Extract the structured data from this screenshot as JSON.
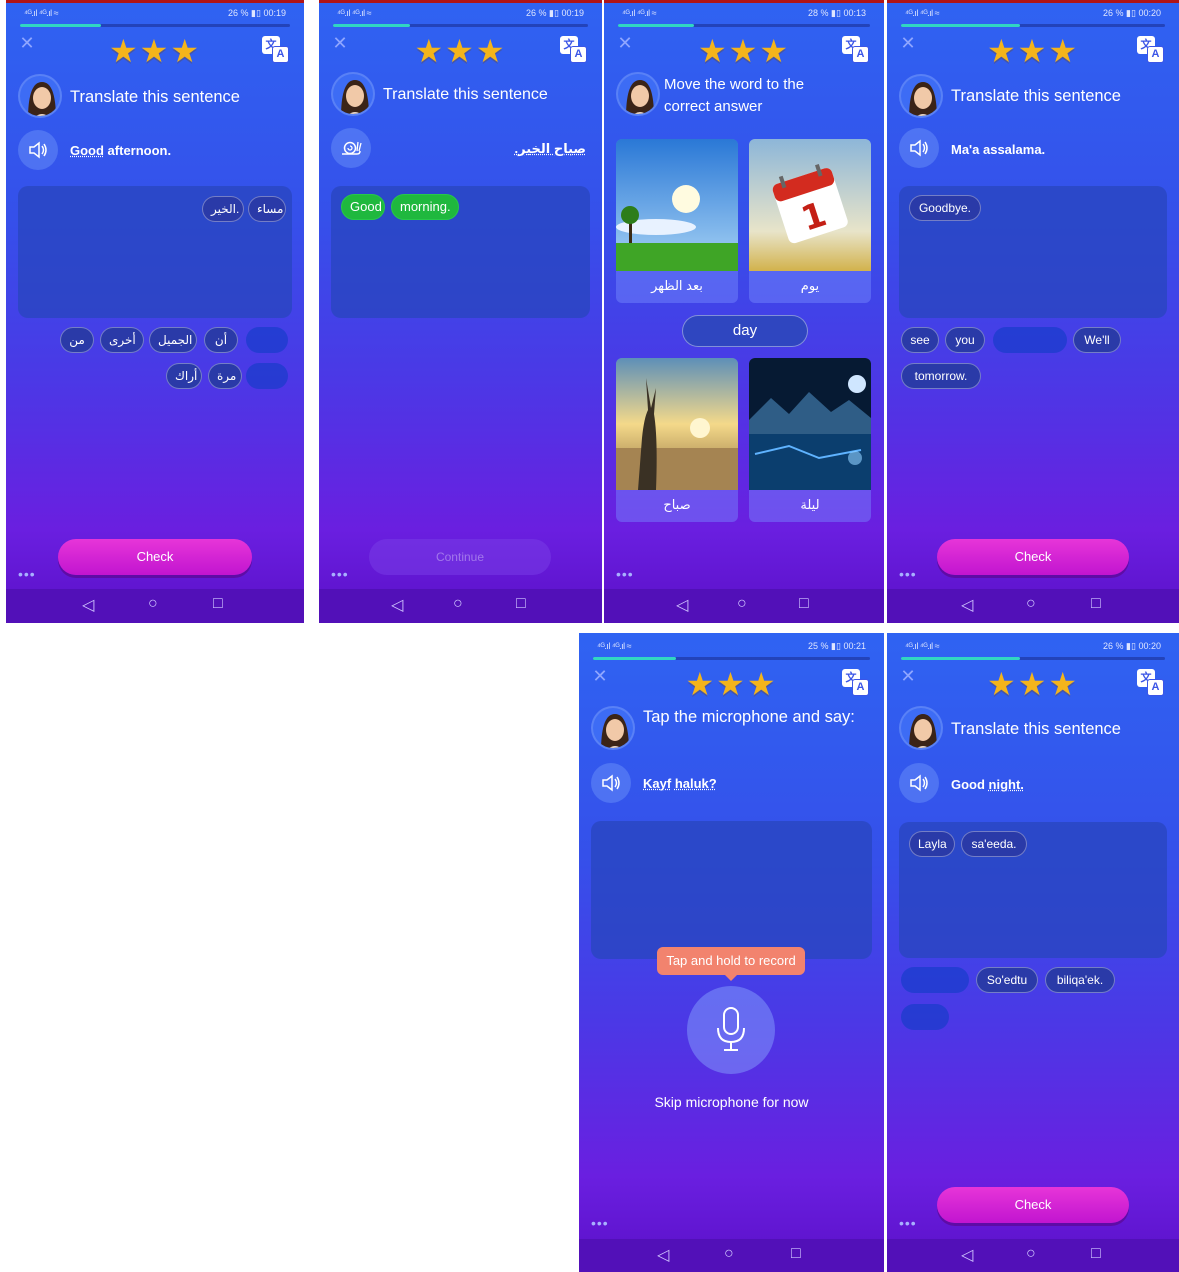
{
  "common": {
    "signal_text": "⁴ᴳ.ıl ⁴ᴳ.ıl ≈",
    "stars": "★★★",
    "close_glyph": "✕",
    "translate_icon_a": "文",
    "translate_icon_b": "A",
    "more_glyph": "•••",
    "nav_back": "◁",
    "nav_home": "○",
    "nav_recent": "□",
    "colors": {
      "check_button": "#d626d4",
      "progress": "#31d6c2",
      "green_chip": "#1fb83e",
      "tooltip": "#f2836e",
      "stars": "#f4b41b"
    }
  },
  "screens": [
    {
      "status": "26 % ▮▯ 00:19",
      "progress": 0.3,
      "prompt": "Translate this sentence",
      "sentence_u": "Good",
      "sentence_rest": " afternoon.",
      "answer_chips": [
        "مساء",
        "الخير."
      ],
      "bank_row1": [
        "أن",
        "الجميل",
        "أخرى",
        "من"
      ],
      "bank_row2": [
        "مرة",
        "أراك"
      ],
      "button": "Check"
    },
    {
      "status": "26 % ▮▯ 00:19",
      "progress": 0.3,
      "prompt": "Translate this sentence",
      "sentence_rtl": "صباح الخير.",
      "answer_chips": [
        "Good",
        "morning."
      ],
      "button": "Continue"
    },
    {
      "status": "28 % ▮▯ 00:13",
      "progress": 0.3,
      "prompt": "Move the word to the correct answer",
      "cards": [
        "بعد الظهر",
        "يوم",
        "صباح",
        "ليلة"
      ],
      "word": "day"
    },
    {
      "status": "26 % ▮▯ 00:20",
      "progress": 0.45,
      "prompt": "Translate this sentence",
      "sentence": "Ma'a assalama.",
      "answer_chips": [
        "Goodbye."
      ],
      "bank_row1": [
        "see",
        "you",
        "We'll"
      ],
      "bank_row2": [
        "tomorrow."
      ],
      "button": "Check"
    },
    {
      "status": "25 % ▮▯ 00:21",
      "progress": 0.3,
      "prompt": "Tap the microphone and say:",
      "sentence_u1": "Kayf",
      "sentence_u2": "haluk?",
      "tooltip": "Tap and hold to record",
      "skip": "Skip microphone for now"
    },
    {
      "status": "26 % ▮▯ 00:20",
      "progress": 0.45,
      "prompt": "Translate this sentence",
      "sentence_rest": "Good ",
      "sentence_u": "night.",
      "answer_chips": [
        "Layla",
        "sa'eeda."
      ],
      "bank_row1": [
        "So'edtu",
        "biliqa'ek."
      ],
      "button": "Check"
    }
  ]
}
